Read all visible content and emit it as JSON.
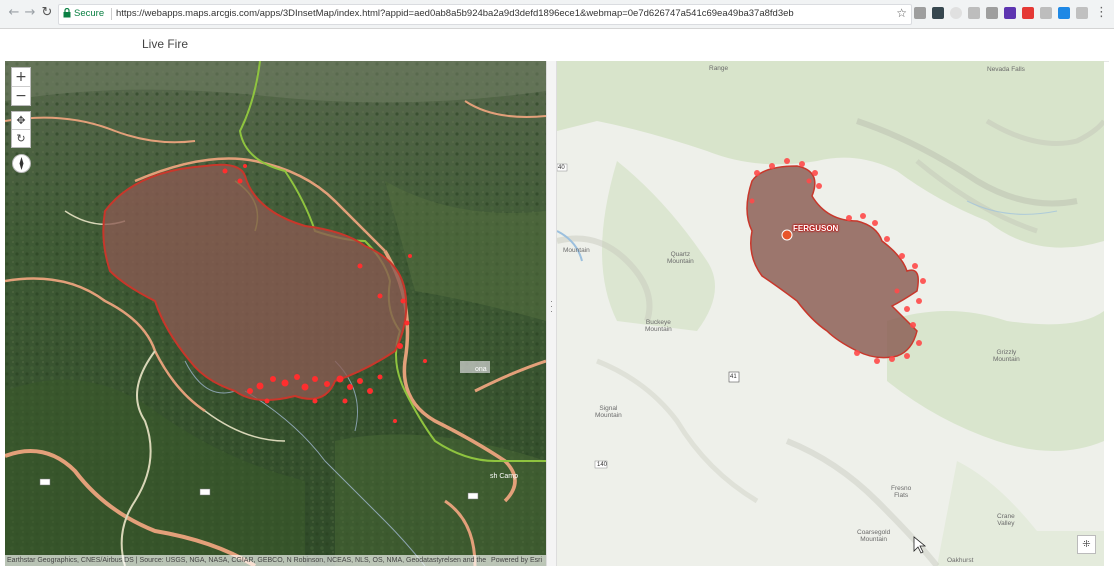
{
  "browser": {
    "security_label": "Secure",
    "url": "https://webapps.maps.arcgis.com/apps/3DInsetMap/index.html?appid=aed0ab8a5b924ba2a9d3defd1896ece1&webmap=0e7d626747a541c69ea49ba37a8fd3eb",
    "back_icon": "back-arrow-icon",
    "forward_icon": "forward-arrow-icon",
    "reload_icon": "reload-icon"
  },
  "app": {
    "title": "Live Fire"
  },
  "scene_view": {
    "zoom_in": "+",
    "zoom_out": "−",
    "pan_icon": "✥",
    "rotate_icon": "↻",
    "compass_icon": "compass-icon",
    "attribution": "Earthstar Geographics, CNES/Airbus DS | Source: USGS, NGA, NASA, CGIAR, GEBCO, N Robinson, NCEAS, NLS, OS, NMA, Geodatastyrelsen and the GIS ...",
    "powered_by": "Powered by Esri",
    "labels": {
      "camp": "sh Camp",
      "lorona": "ona"
    }
  },
  "map_view": {
    "fire_label": "FERGUSON",
    "basemap_icon": "basemap-gallery-icon",
    "labels": {
      "range": "Range",
      "peak": "Nevada Falls",
      "mountain": "Mountain",
      "quartz": "Quartz\nMountain",
      "buckeye": "Buckeye\nMountain",
      "signal": "Signal\nMountain",
      "fresno": "Fresno\nFlats",
      "coarse": "Coarsegold\nMountain",
      "crane": "Crane\nValley",
      "grizzly": "Grizzly\nMountain",
      "eastern": "Oakhurst",
      "num40": "40",
      "num140": "140",
      "num1": "41"
    }
  },
  "colors": {
    "fire_perimeter": "#c8372b",
    "fire_fill": "#8a5a52",
    "hotspot": "#ff2e2e",
    "road_major": "#e3a07a",
    "boundary": "#8fc43f"
  }
}
